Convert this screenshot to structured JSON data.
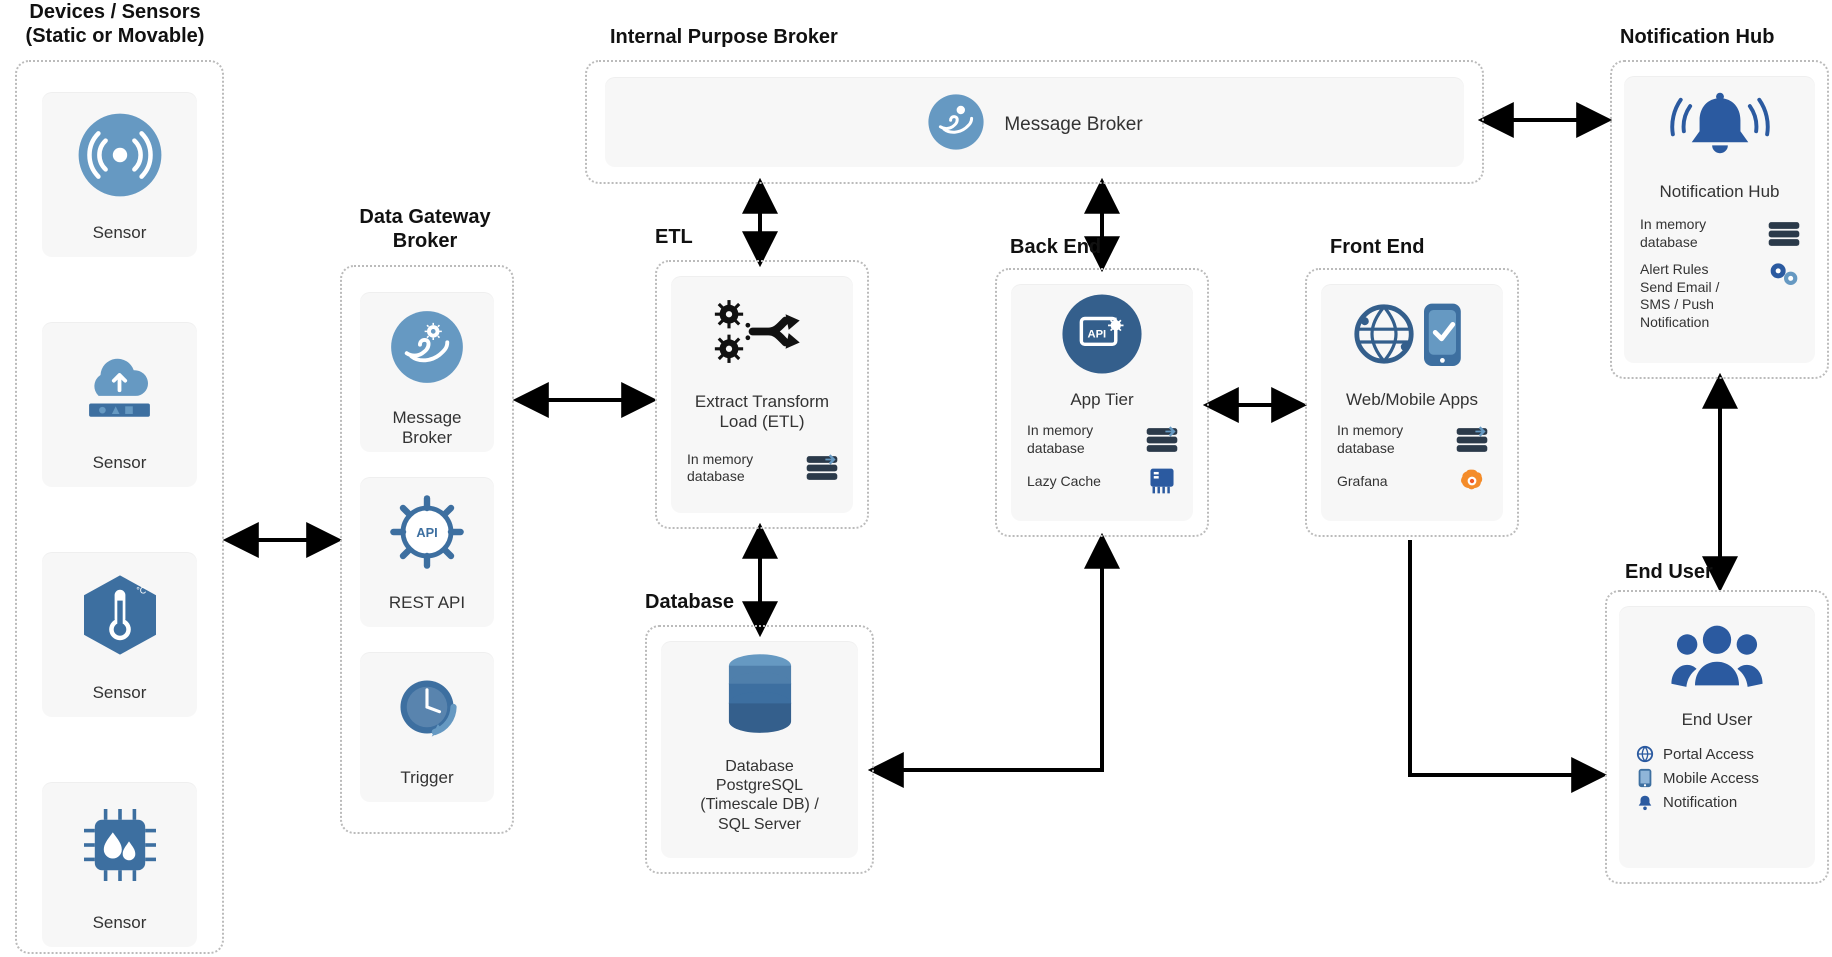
{
  "groups": {
    "devices": {
      "title": "Devices / Sensors\n(Static or Movable)"
    },
    "gateway": {
      "title": "Data Gateway\nBroker"
    },
    "broker": {
      "title": "Internal Purpose Broker"
    },
    "etl": {
      "title": "ETL"
    },
    "db": {
      "title": "Database"
    },
    "backend": {
      "title": "Back End"
    },
    "frontend": {
      "title": "Front End"
    },
    "nhub": {
      "title": "Notification Hub"
    },
    "enduser": {
      "title": "End User"
    }
  },
  "cards": {
    "sensor1": "Sensor",
    "sensor2": "Sensor",
    "sensor3": "Sensor",
    "sensor4": "Sensor",
    "msgbroker_gw": "Message\nBroker",
    "restapi": "REST API",
    "trigger": "Trigger",
    "msgbroker_top": "Message Broker",
    "etl": "Extract Transform\nLoad (ETL)",
    "apptier": "App Tier",
    "webmobile": "Web/Mobile Apps",
    "nhub": "Notification Hub",
    "database": "Database\nPostgreSQL\n(Timescale DB) /\nSQL Server",
    "enduser": "End User"
  },
  "subs": {
    "etl_mem": "In memory\ndatabase",
    "app_mem": "In memory\ndatabase",
    "app_lazy": "Lazy Cache",
    "web_mem": "In memory\ndatabase",
    "web_graf": "Grafana",
    "nh_mem": "In memory\ndatabase",
    "nh_rules": "Alert Rules\nSend Email /\nSMS / Push Notification"
  },
  "enduser_list": {
    "portal": "Portal Access",
    "mobile": "Mobile Access",
    "notif": "Notification"
  }
}
